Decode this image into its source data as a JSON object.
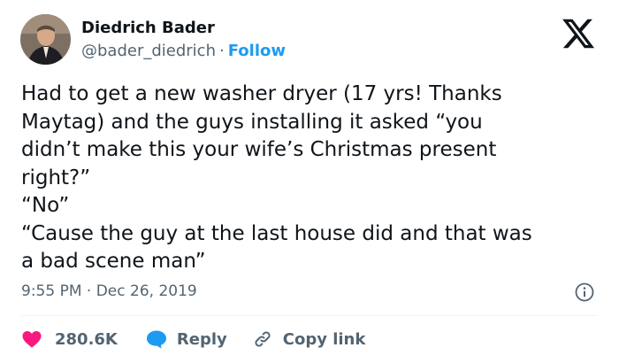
{
  "author": {
    "name": "Diedrich Bader",
    "handle": "@bader_diedrich",
    "separator": "·",
    "follow_label": "Follow"
  },
  "tweet": {
    "lines": [
      "Had to get a new washer dryer (17 yrs! Thanks",
      "Maytag) and the guys installing it asked “you",
      "didn’t make this your wife’s Christmas present",
      "right?”",
      "“No”",
      "“Cause the guy at the last house did and that was",
      "a bad scene man”"
    ],
    "time": "9:55 PM · Dec 26, 2019"
  },
  "actions": {
    "like_count": "280.6K",
    "reply_label": "Reply",
    "copy_link_label": "Copy link"
  },
  "icons": {
    "logo": "x-logo-icon",
    "info": "info-icon",
    "like": "heart-icon",
    "reply": "speech-bubble-icon",
    "copy": "link-icon"
  },
  "colors": {
    "text": "#0f1419",
    "secondary": "#536471",
    "follow": "#1d9bf0",
    "like": "#f91880",
    "reply": "#1d9bf0"
  }
}
